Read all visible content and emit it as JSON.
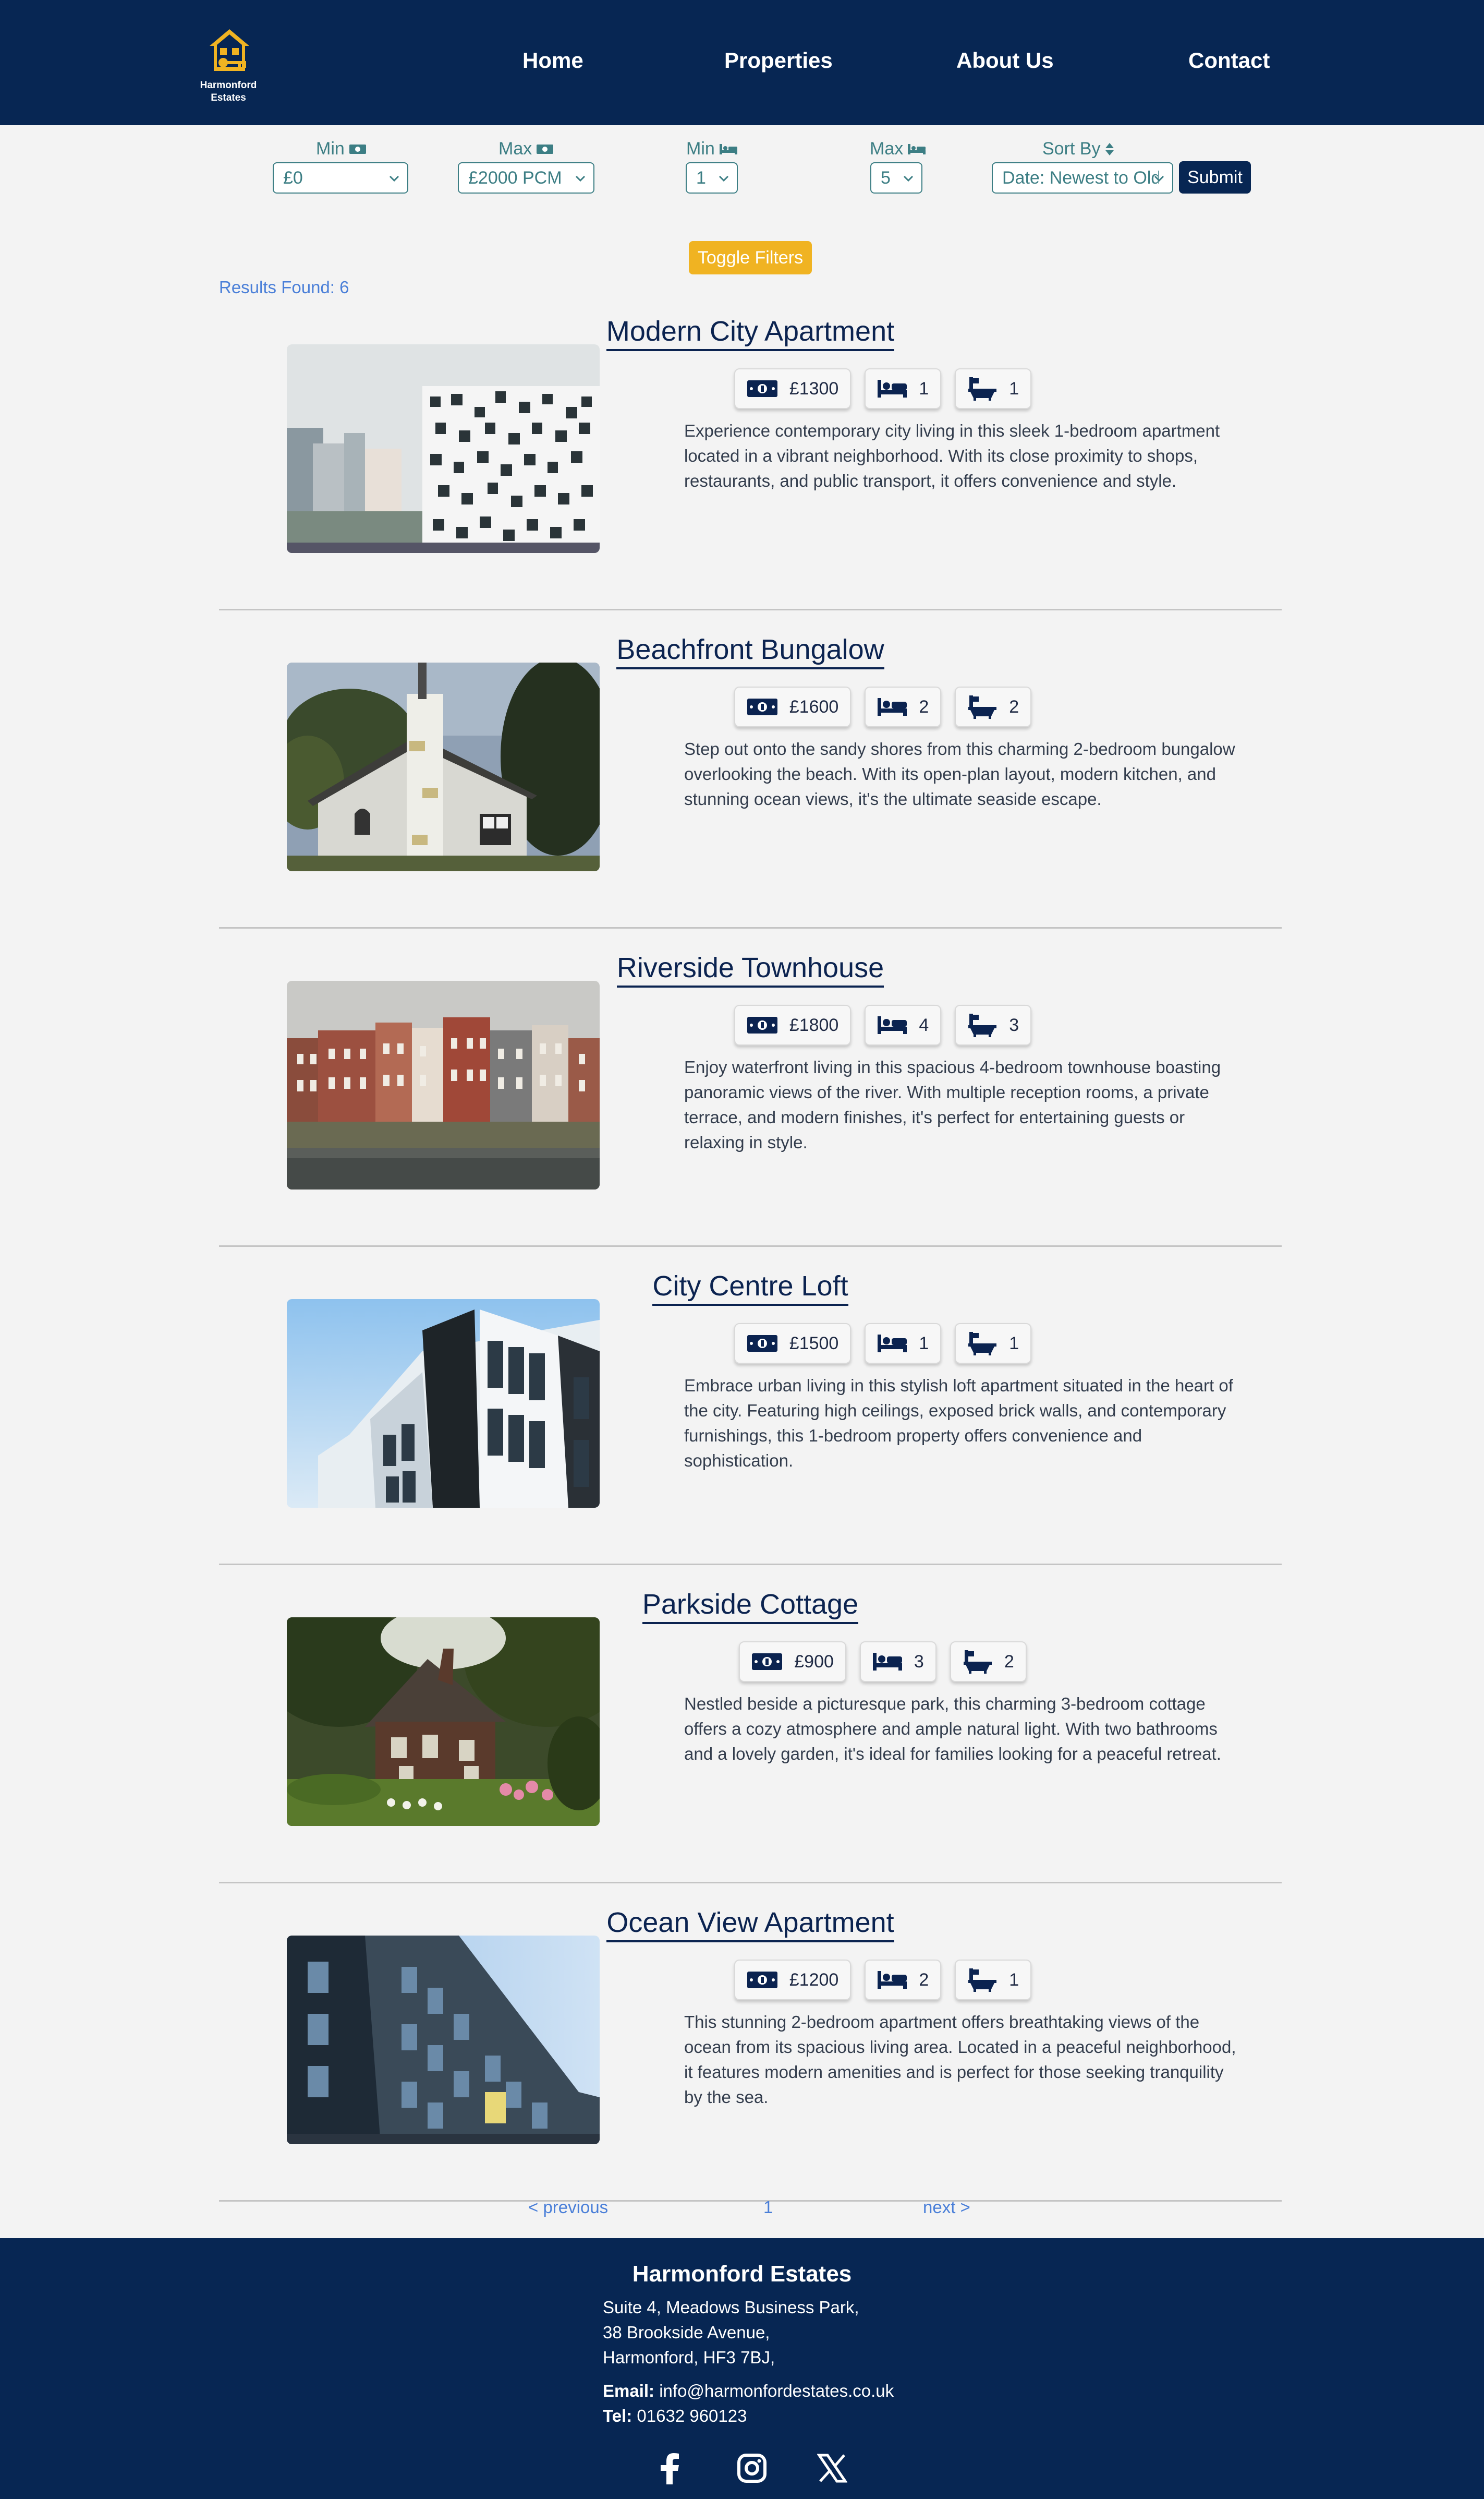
{
  "brand": {
    "name_line1": "Harmonford",
    "name_line2": "Estates",
    "logo_color": "#f0b322"
  },
  "nav": {
    "home": "Home",
    "properties": "Properties",
    "about": "About Us",
    "contact": "Contact"
  },
  "filters": {
    "min_price_label": "Min",
    "max_price_label": "Max",
    "min_beds_label": "Min",
    "max_beds_label": "Max",
    "sort_label": "Sort By",
    "min_price_value": "£0",
    "max_price_value": "£2000 PCM",
    "min_beds_value": "1",
    "max_beds_value": "5",
    "sort_value": "Date: Newest to Oldest",
    "submit": "Submit",
    "toggle": "Toggle Filters"
  },
  "results": {
    "label": "Results Found: 6"
  },
  "properties": [
    {
      "title": "Modern City Apartment",
      "price": "£1300",
      "beds": "1",
      "baths": "1",
      "desc": "Experience contemporary city living in this sleek 1-bedroom apartment located in a vibrant neighborhood. With its close proximity to shops, restaurants, and public transport, it offers convenience and style."
    },
    {
      "title": "Beachfront Bungalow",
      "price": "£1600",
      "beds": "2",
      "baths": "2",
      "desc": "Step out onto the sandy shores from this charming 2-bedroom bungalow overlooking the beach. With its open-plan layout, modern kitchen, and stunning ocean views, it's the ultimate seaside escape."
    },
    {
      "title": "Riverside Townhouse",
      "price": "£1800",
      "beds": "4",
      "baths": "3",
      "desc": "Enjoy waterfront living in this spacious 4-bedroom townhouse boasting panoramic views of the river. With multiple reception rooms, a private terrace, and modern finishes, it's perfect for entertaining guests or relaxing in style."
    },
    {
      "title": "City Centre Loft",
      "price": "£1500",
      "beds": "1",
      "baths": "1",
      "desc": "Embrace urban living in this stylish loft apartment situated in the heart of the city. Featuring high ceilings, exposed brick walls, and contemporary furnishings, this 1-bedroom property offers convenience and sophistication."
    },
    {
      "title": "Parkside Cottage",
      "price": "£900",
      "beds": "3",
      "baths": "2",
      "desc": "Nestled beside a picturesque park, this charming 3-bedroom cottage offers a cozy atmosphere and ample natural light. With two bathrooms and a lovely garden, it's ideal for families looking for a peaceful retreat."
    },
    {
      "title": "Ocean View Apartment",
      "price": "£1200",
      "beds": "2",
      "baths": "1",
      "desc": "This stunning 2-bedroom apartment offers breathtaking views of the ocean from its spacious living area. Located in a peaceful neighborhood, it features modern amenities and is perfect for those seeking tranquility by the sea."
    }
  ],
  "pagination": {
    "previous": "< previous",
    "current": "1",
    "next": "next >"
  },
  "footer": {
    "title": "Harmonford Estates",
    "address1": "Suite 4, Meadows Business Park,",
    "address2": "38 Brookside Avenue,",
    "address3": "Harmonford, HF3 7BJ,",
    "email_label": "Email:",
    "email": "info@harmonfordestates.co.uk",
    "tel_label": "Tel:",
    "tel": "01632 960123",
    "social": [
      "facebook-icon",
      "instagram-icon",
      "x-icon"
    ]
  },
  "colors": {
    "navy": "#072653",
    "accent": "#f0b322",
    "teal": "#3c7e84",
    "link": "#4a7fd8",
    "background": "#f3f3f3"
  }
}
